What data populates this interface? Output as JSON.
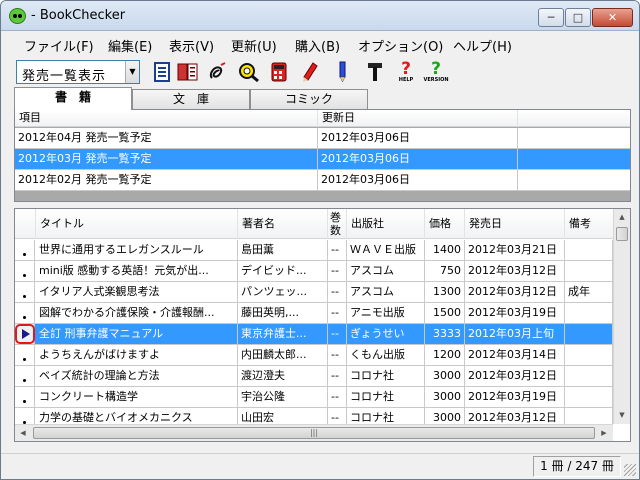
{
  "window": {
    "title": "- BookChecker"
  },
  "menu": [
    "ファイル(F)",
    "編集(E)",
    "表示(V)",
    "更新(U)",
    "購入(B)",
    "オプション(O)",
    "ヘルプ(H)"
  ],
  "toolbar": {
    "view_select": "発売一覧表示",
    "help_label": "HELP",
    "version_label": "VERSION"
  },
  "tabs": [
    "書　籍",
    "文　庫",
    "コミック"
  ],
  "lists": {
    "headers": [
      "項目",
      "更新日"
    ],
    "rows": [
      {
        "item": "2012年04月 発売一覧予定",
        "date": "2012年03月06日"
      },
      {
        "item": "2012年03月 発売一覧予定",
        "date": "2012年03月06日"
      },
      {
        "item": "2012年02月 発売一覧予定",
        "date": "2012年03月06日"
      }
    ]
  },
  "books": {
    "headers": {
      "title": "タイトル",
      "author": "著者名",
      "volume": "巻数",
      "publisher": "出版社",
      "price": "価格",
      "date": "発売日",
      "note": "備考"
    },
    "rows": [
      {
        "title": "世界に通用するエレガンスルール",
        "author": "島田薫",
        "volume": "--",
        "publisher": "ＷＡＶＥ出版",
        "price": "1400",
        "date": "2012年03月21日",
        "note": ""
      },
      {
        "title": "mini版 感動する英語！元気が出...",
        "author": "デイビッド...",
        "volume": "--",
        "publisher": "アスコム",
        "price": "750",
        "date": "2012年03月12日",
        "note": ""
      },
      {
        "title": "イタリア人式楽観思考法",
        "author": "パンツェッ...",
        "volume": "--",
        "publisher": "アスコム",
        "price": "1300",
        "date": "2012年03月12日",
        "note": "成年"
      },
      {
        "title": "図解でわかる介護保険・介護報酬...",
        "author": "藤田英明,...",
        "volume": "--",
        "publisher": "アニモ出版",
        "price": "1500",
        "date": "2012年03月19日",
        "note": ""
      },
      {
        "title": "全訂 刑事弁護マニュアル",
        "author": "東京弁護士...",
        "volume": "--",
        "publisher": "ぎょうせい",
        "price": "3333",
        "date": "2012年03月上旬",
        "note": ""
      },
      {
        "title": "ようちえんがばけますよ",
        "author": "内田麟太郎...",
        "volume": "--",
        "publisher": "くもん出版",
        "price": "1200",
        "date": "2012年03月14日",
        "note": ""
      },
      {
        "title": "ベイズ統計の理論と方法",
        "author": "渡辺澄夫",
        "volume": "--",
        "publisher": "コロナ社",
        "price": "3000",
        "date": "2012年03月12日",
        "note": ""
      },
      {
        "title": "コンクリート構造学",
        "author": "宇治公隆",
        "volume": "--",
        "publisher": "コロナ社",
        "price": "3000",
        "date": "2012年03月19日",
        "note": ""
      },
      {
        "title": "力学の基礎とバイオメカニクス",
        "author": "山田宏",
        "volume": "--",
        "publisher": "コロナ社",
        "price": "3000",
        "date": "2012年03月12日",
        "note": ""
      }
    ]
  },
  "status": {
    "count": "1 冊 / 247 冊"
  }
}
